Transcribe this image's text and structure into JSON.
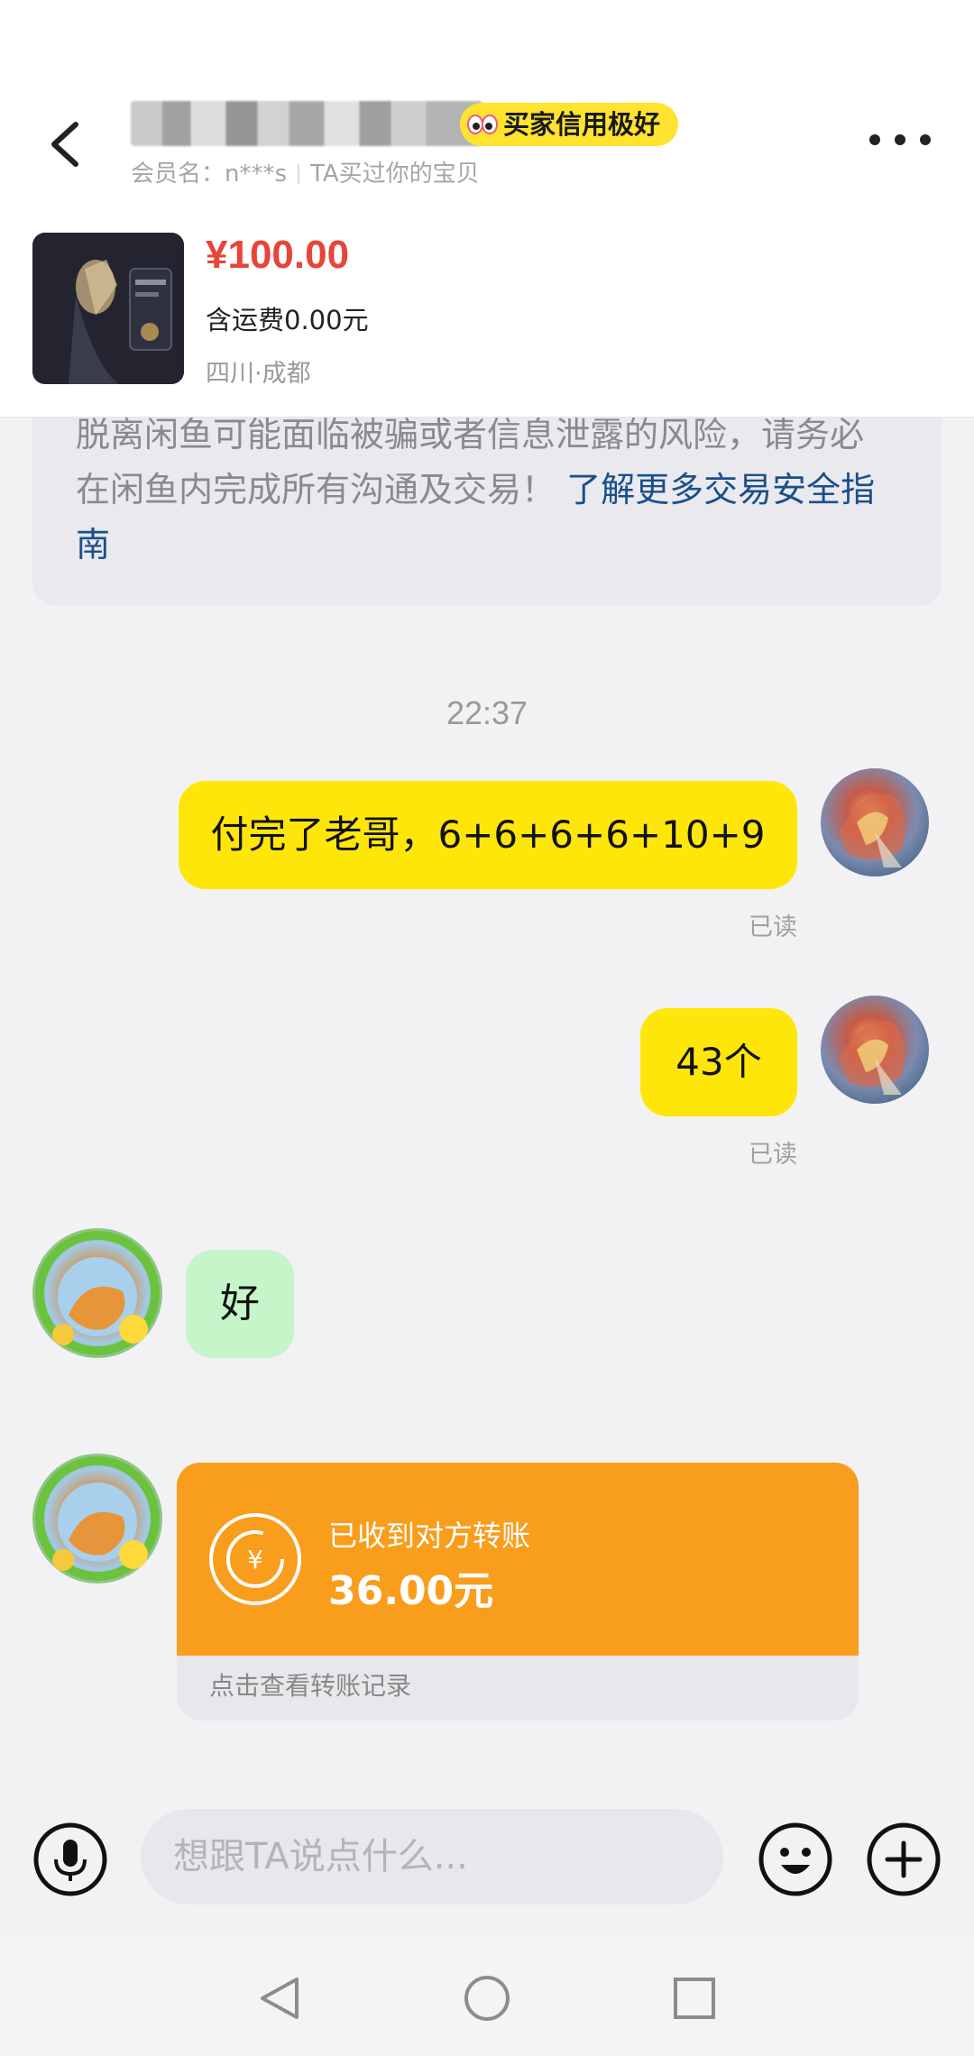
{
  "header": {
    "credit_badge": "买家信用极好",
    "member_label": "会员名：n***s",
    "member_note": "TA买过你的宝贝"
  },
  "product": {
    "price": "¥100.00",
    "shipping": "含运费0.00元",
    "location": "四川·成都"
  },
  "notice": {
    "text": "脱离闲鱼可能面临被骗或者信息泄露的风险，请务必在闲鱼内完成所有沟通及交易！ ",
    "link": "了解更多交易安全指南"
  },
  "messages": {
    "timestamp": "22:37",
    "mine_1": "付完了老哥，6+6+6+6+10+9",
    "mine_1_status": "已读",
    "mine_2": "43个",
    "mine_2_status": "已读",
    "theirs_1": "好"
  },
  "transfer": {
    "title": "已收到对方转账",
    "amount": "36.00元",
    "footer": "点击查看转账记录"
  },
  "input": {
    "placeholder": "想跟TA说点什么..."
  },
  "colors": {
    "accent_yellow": "#ffe60a",
    "price_red": "#e8443a",
    "transfer_orange": "#f99d1c",
    "reply_green": "#c5f5c9",
    "link_blue": "#1b4f8a"
  },
  "icons": {
    "back": "chevron-left-icon",
    "more": "more-dots-icon",
    "voice": "microphone-icon",
    "emoji": "smiley-icon",
    "plus": "plus-icon",
    "transfer": "yuan-transfer-icon",
    "nav_back": "triangle-back-icon",
    "nav_home": "circle-home-icon",
    "nav_recent": "square-recents-icon"
  }
}
